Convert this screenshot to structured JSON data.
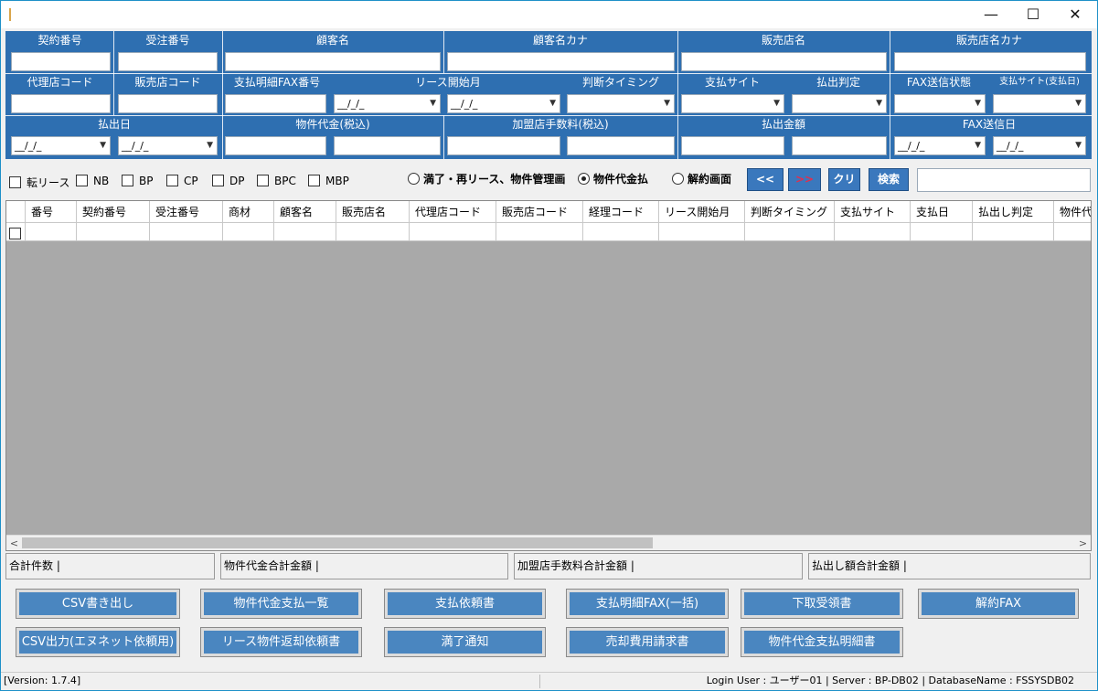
{
  "window": {
    "minimize": "—",
    "maximize": "☐",
    "close": "✕"
  },
  "header": {
    "row1": [
      "契約番号",
      "受注番号",
      "顧客名",
      "顧客名カナ",
      "販売店名",
      "販売店名カナ"
    ],
    "row2": [
      "代理店コード",
      "販売店コード",
      "支払明細FAX番号",
      "リース開始月",
      "判断タイミング",
      "支払サイト",
      "払出判定",
      "FAX送信状態",
      "支払サイト(支払日)"
    ],
    "row3": [
      "払出日",
      "物件代金(税込)",
      "加盟店手数料(税込)",
      "払出金額",
      "FAX送信日"
    ],
    "date_placeholder": "__/_/_",
    "dropdown_arrow": "▼"
  },
  "filters": {
    "checkboxes": [
      "転リース",
      "NB",
      "BP",
      "CP",
      "DP",
      "BPC",
      "MBP"
    ],
    "radios": [
      "満了・再リース、物件管理画",
      "物件代金払",
      "解約画面"
    ],
    "selected_radio": 1,
    "prev_label": "<<",
    "next_label": ">>",
    "clear_label": "クリ",
    "search_label": "検索"
  },
  "grid": {
    "columns": [
      "",
      "番号",
      "契約番号",
      "受注番号",
      "商材",
      "顧客名",
      "販売店名",
      "代理店コード",
      "販売店コード",
      "経理コード",
      "リース開始月",
      "判断タイミング",
      "支払サイト",
      "支払日",
      "払出し判定",
      "物件代"
    ],
    "scroll_left": "<",
    "scroll_right": ">"
  },
  "totals": [
    "合計件数 |",
    "物件代金合計金額 |",
    "加盟店手数料合計金額 |",
    "払出し額合計金額 |"
  ],
  "actions": {
    "row1": [
      "CSV書き出し",
      "物件代金支払一覧",
      "支払依頼書",
      "支払明細FAX(一括)",
      "下取受領書",
      "解約FAX"
    ],
    "row2": [
      "CSV出力(エヌネット依頼用)",
      "リース物件返却依頼書",
      "満了通知",
      "売却費用請求書",
      "物件代金支払明細書"
    ]
  },
  "status": {
    "version": "[Version: 1.7.4]",
    "login": "Login User : ユーザー01 | Server : BP-DB02 | DatabaseName : FSSYSDB02"
  },
  "colors": {
    "header_bg": "#2e6fb1",
    "button_bg": "#4a86c0",
    "grid_bg": "#a9a9a9"
  }
}
